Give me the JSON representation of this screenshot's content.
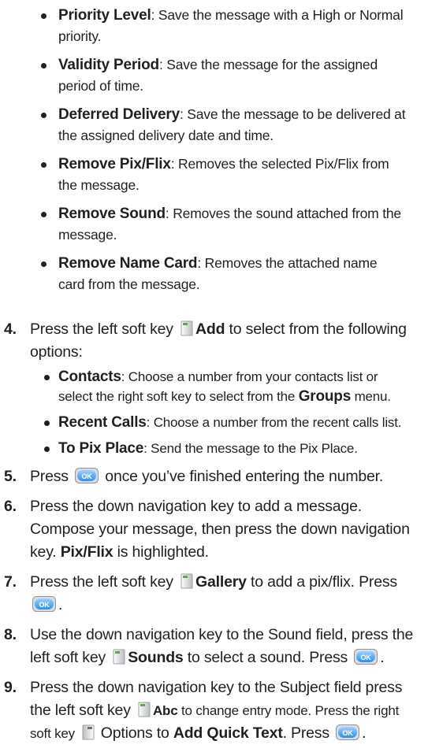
{
  "bullets": [
    {
      "term": "Priority Level",
      "text": ": Save the message with a High or Normal priority."
    },
    {
      "term": "Validity Period",
      "text": ": Save the message for the assigned period of time."
    },
    {
      "term": "Deferred Delivery",
      "text": ": Save the message to be delivered at the assigned delivery date and time."
    },
    {
      "term": "Remove Pix/Flix",
      "text": ": Removes the selected Pix/Flix from the message."
    },
    {
      "term": "Remove Sound",
      "text": ": Removes the sound attached from the message."
    },
    {
      "term": "Remove Name Card",
      "text": ": Removes the attached name card from the message."
    }
  ],
  "steps": {
    "s4": {
      "num": "4.",
      "a": "Press the left soft key ",
      "add": "Add",
      "b": " to select from the following options:",
      "sub": [
        {
          "term": "Contacts",
          "text": ": Choose a number from your contacts list or select the right soft key to select from the ",
          "term2": "Groups",
          "text2": " menu."
        },
        {
          "term": "Recent Calls",
          "text": ": Choose a number from the recent calls list."
        },
        {
          "term": "To Pix Place",
          "text": ": Send the message to the Pix Place."
        }
      ]
    },
    "s5": {
      "num": "5.",
      "a": "Press ",
      "b": " once you’ve finished entering the number."
    },
    "s6": {
      "num": "6.",
      "a": "Press the down navigation key to add a message. Compose your message, then press the down navigation key. ",
      "bold": "Pix/Flix",
      "b": " is highlighted."
    },
    "s7": {
      "num": "7.",
      "a": "Press the left soft key ",
      "bold": "Gallery",
      "b": " to add a pix/flix. Press ",
      "c": "."
    },
    "s8": {
      "num": "8.",
      "a": "Use the down navigation key to the Sound field, press the left soft key ",
      "bold": "Sounds",
      "b": " to select a sound. Press ",
      "c": "."
    },
    "s9": {
      "num": "9.",
      "a": "Press the down navigation key to the Subject field press the left soft key ",
      "bold": "Abc",
      "b": " to change entry mode. Press the right soft key ",
      "c": " Options to ",
      "bold2": "Add Quick Text",
      "d": ". Press ",
      "e": "."
    }
  },
  "icons": {
    "left_soft_key": "left-soft-key-icon",
    "right_soft_key": "right-soft-key-icon",
    "ok_key": "ok-key-icon"
  },
  "colors": {
    "text": "#231f20",
    "ok_key": "#2f8fe0"
  }
}
